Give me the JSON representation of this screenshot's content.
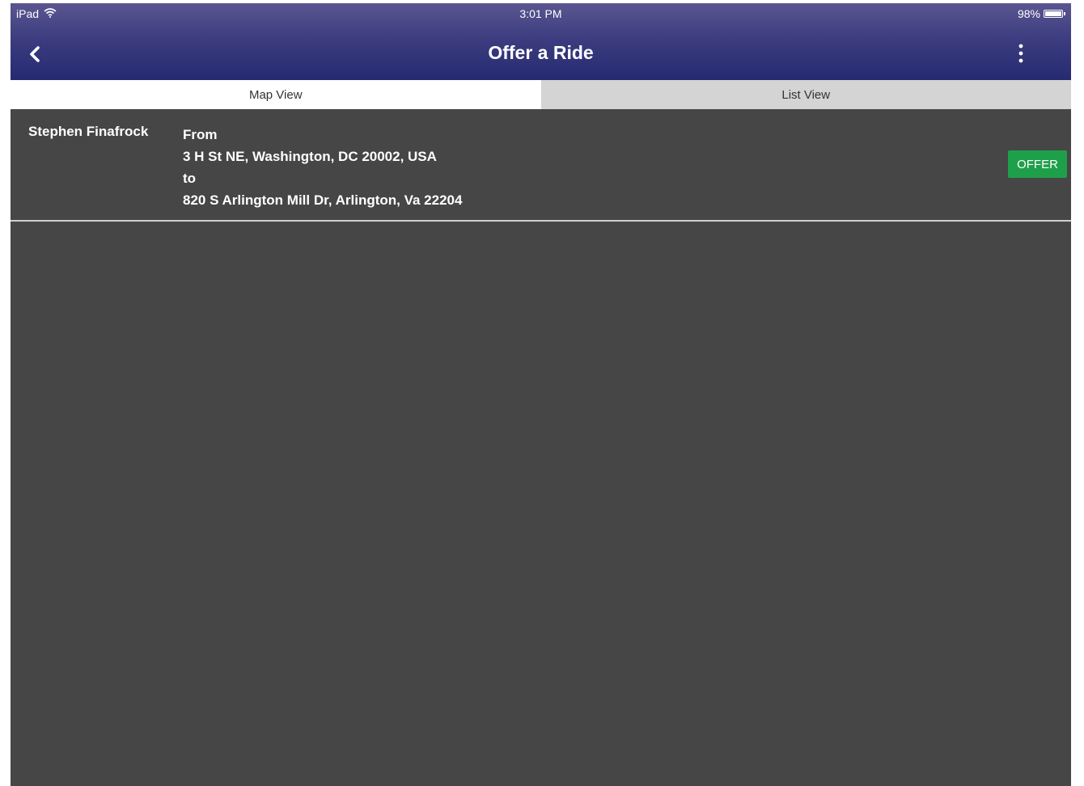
{
  "status_bar": {
    "device": "iPad",
    "time": "3:01 PM",
    "battery_text": "98%",
    "battery_level": 0.98
  },
  "nav": {
    "title": "Offer a Ride",
    "back_icon": "chevron-left-icon",
    "menu_icon": "more-vertical-icon"
  },
  "tabs": [
    {
      "label": "Map View",
      "active": true
    },
    {
      "label": "List View",
      "active": false
    }
  ],
  "rides": [
    {
      "name": "Stephen Finafrock",
      "from_label": "From",
      "from_address": "3 H St NE, Washington, DC 20002, USA",
      "to_label": "to",
      "to_address": "820 S Arlington Mill Dr, Arlington, Va 22204",
      "action_label": "OFFER"
    }
  ],
  "colors": {
    "header_top": "#5a5690",
    "header_bottom": "#252a70",
    "content_bg": "#464646",
    "offer_button": "#1ea04a",
    "tab_active": "#ffffff",
    "tab_inactive": "#d4d4d4"
  }
}
